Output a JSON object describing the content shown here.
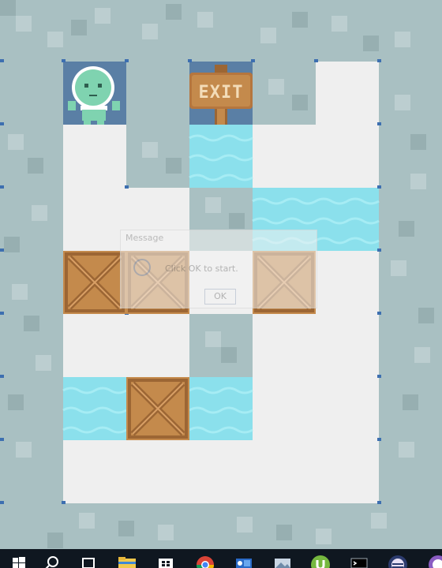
{
  "game": {
    "exit_sign": "EXIT"
  },
  "dialog": {
    "title": "Message",
    "message": "Click OK to start.",
    "ok_label": "OK"
  },
  "taskbar": {
    "icons": [
      "windows-start-icon",
      "search-icon",
      "task-view-icon",
      "file-explorer-icon",
      "store-icon",
      "chrome-icon",
      "outlook-icon",
      "photos-icon",
      "utorrent-icon",
      "terminal-icon",
      "app-icon",
      "app-icon-2"
    ]
  },
  "colors": {
    "floor": "#efefef",
    "wall": "#a9c0c2",
    "water": "#8be0ec",
    "crate": "#c48a4c",
    "character": "#7fd3b0"
  }
}
